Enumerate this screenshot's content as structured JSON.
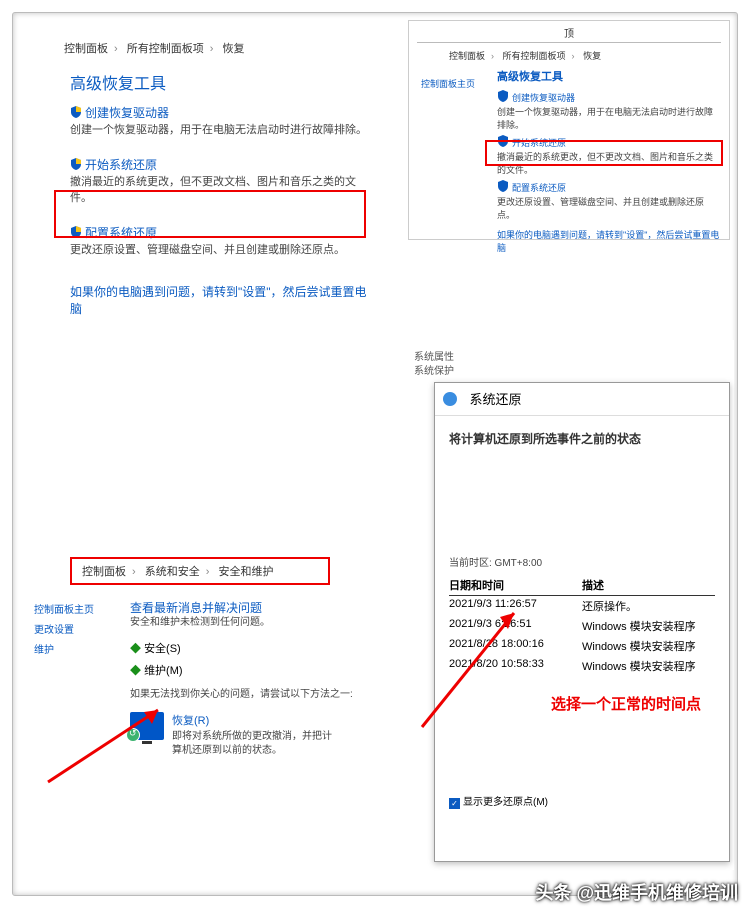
{
  "outer": {
    "tl": {
      "breadcrumb": [
        "控制面板",
        "所有控制面板项",
        "恢复"
      ],
      "title": "高级恢复工具",
      "item1_link": "创建恢复驱动器",
      "item1_desc": "创建一个恢复驱动器，用于在电脑无法启动时进行故障排除。",
      "item2_link": "开始系统还原",
      "item2_desc": "撤消最近的系统更改，但不更改文档、图片和音乐之类的文件。",
      "item3_link": "配置系统还原",
      "item3_desc": "更改还原设置、管理磁盘空间、并且创建或删除还原点。",
      "footer": "如果你的电脑遇到问题，请转到\"设置\"，然后尝试重置电脑"
    },
    "tr": {
      "toptext": "顶",
      "breadcrumb": [
        "控制面板",
        "所有控制面板项",
        "恢复"
      ],
      "sidebar": "控制面板主页",
      "title": "高级恢复工具",
      "item1_link": "创建恢复驱动器",
      "item1_desc": "创建一个恢复驱动器，用于在电脑无法启动时进行故障排除。",
      "item2_link": "开始系统还原",
      "item2_desc": "撤消最近的系统更改，但不更改文档、图片和音乐之类的文件。",
      "item3_link": "配置系统还原",
      "item3_desc": "更改还原设置、管理磁盘空间、并且创建或删除还原点。",
      "footer": "如果你的电脑遇到问题，请转到\"设置\"，然后尝试重置电脑"
    },
    "bl": {
      "breadcrumb": [
        "控制面板",
        "系统和安全",
        "安全和维护"
      ],
      "sidebar1": "控制面板主页",
      "sidebar2": "更改设置",
      "sidebar3": "维护",
      "main_title": "查看最新消息并解决问题",
      "main_sub": "安全和维护未检测到任何问题。",
      "sec_label": "安全(S)",
      "maint_label": "维护(M)",
      "probtext": "如果无法找到你关心的问题，请尝试以下方法之一:",
      "recov_link": "恢复(R)",
      "recov_desc1": "即将对系统所做的更改撤消，并把计",
      "recov_desc2": "算机还原到以前的状态。"
    },
    "br": {
      "side1": "系统属性",
      "side2": "系统保护",
      "win_title": "系统还原",
      "heading": "将计算机还原到所选事件之前的状态",
      "tz": "当前时区: GMT+8:00",
      "col1": "日期和时间",
      "col2": "描述",
      "rows": [
        {
          "dt": "2021/9/3 11:26:57",
          "d": "还原操作。"
        },
        {
          "dt": "2021/9/3 6:26:51",
          "d": "Windows 模块安装程序"
        },
        {
          "dt": "2021/8/28 18:00:16",
          "d": "Windows 模块安装程序"
        },
        {
          "dt": "2021/8/20 10:58:33",
          "d": "Windows 模块安装程序"
        }
      ],
      "annot": "选择一个正常的时间点",
      "checkbox": "显示更多还原点(M)"
    }
  },
  "watermark": "头条 @迅维手机维修培训"
}
